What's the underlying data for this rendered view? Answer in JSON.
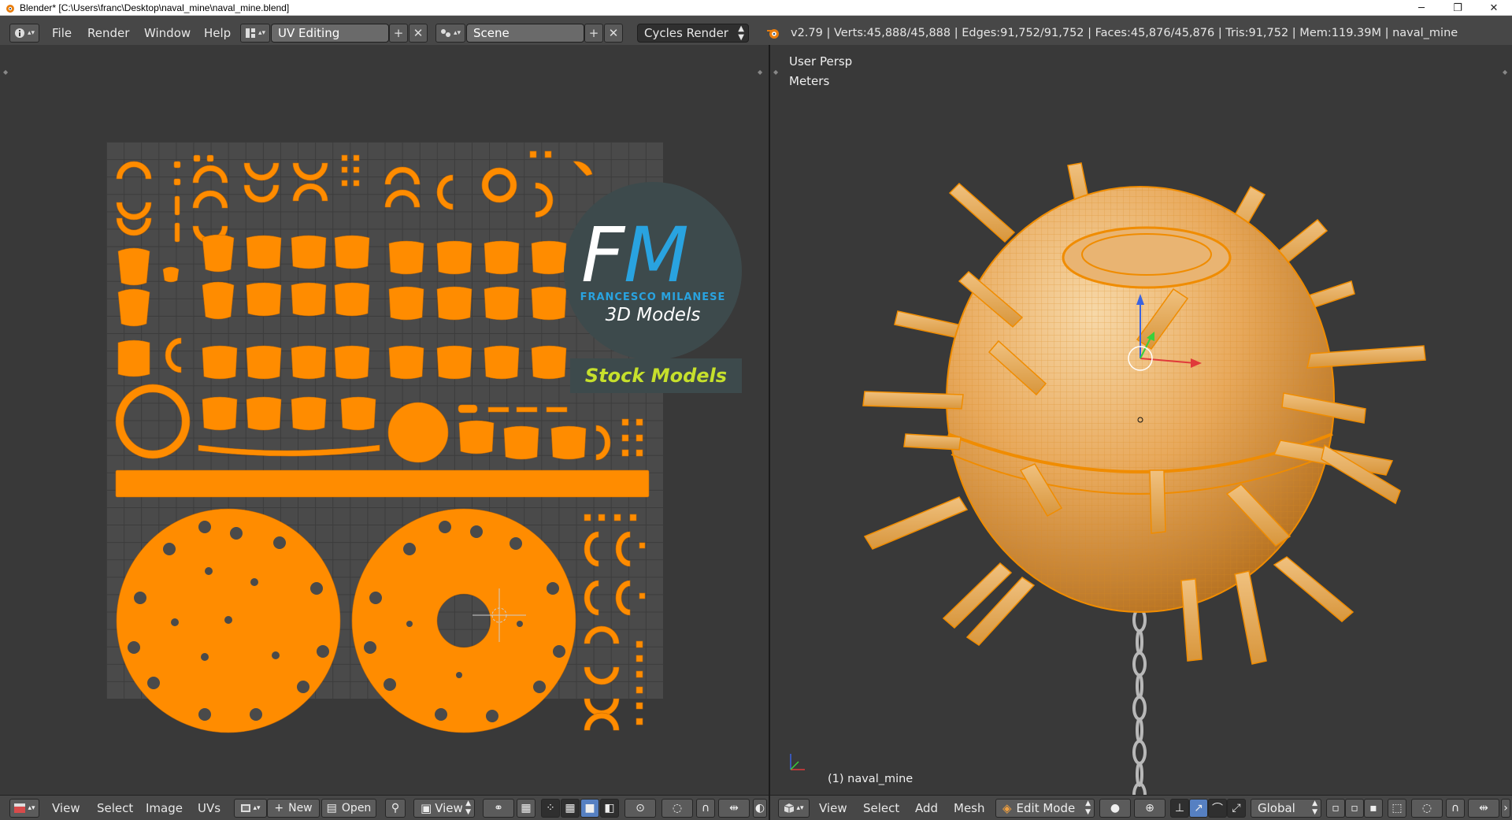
{
  "window": {
    "title": "Blender* [C:\\Users\\franc\\Desktop\\naval_mine\\naval_mine.blend]",
    "controls": {
      "minimize": "─",
      "maximize": "❐",
      "close": "✕"
    }
  },
  "infobar": {
    "menus": [
      "File",
      "Render",
      "Window",
      "Help"
    ],
    "layout": "UV Editing",
    "scene": "Scene",
    "engine": "Cycles Render",
    "stats": "v2.79 | Verts:45,888/45,888 | Edges:91,752/91,752 | Faces:45,876/45,876 | Tris:91,752 | Mem:119.39M | naval_mine"
  },
  "uv_editor": {
    "header": {
      "menus": [
        "View",
        "Select",
        "Image",
        "UVs"
      ],
      "new_label": "New",
      "open_label": "Open",
      "view_label": "View"
    }
  },
  "viewport": {
    "view_name": "User Persp",
    "units": "Meters",
    "object_label": "(1) naval_mine",
    "header": {
      "menus": [
        "View",
        "Select",
        "Add",
        "Mesh"
      ],
      "mode": "Edit Mode",
      "orientation": "Global"
    }
  },
  "watermark": {
    "logo_text": "FM",
    "author": "FRANCESCO MILANESE",
    "subtitle": "3D Models",
    "badge": "Stock Models"
  },
  "colors": {
    "uv_island": "#ff8c00",
    "mesh": "#f5a623",
    "panel_bg": "#393939",
    "header_bg": "#474747",
    "accent_blue": "#29a3e0",
    "badge_text": "#c6e02c"
  }
}
